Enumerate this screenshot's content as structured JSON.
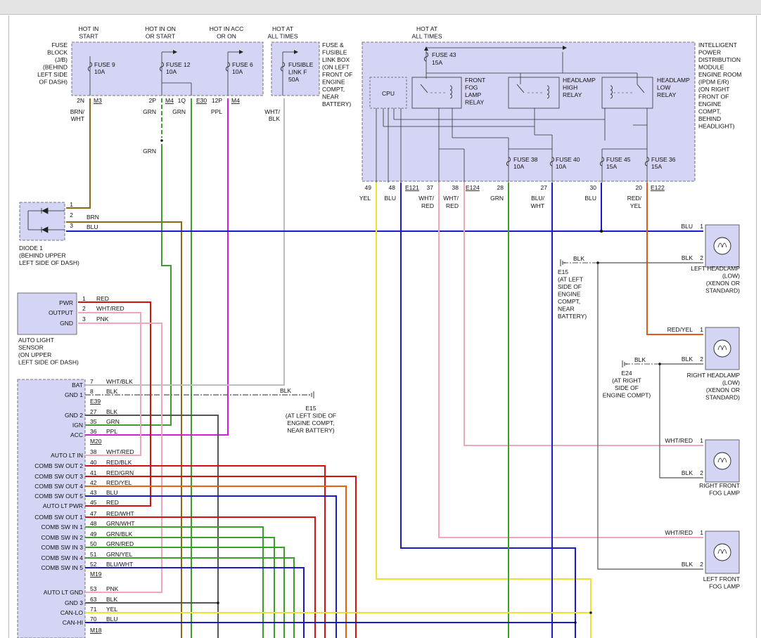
{
  "header_columns": [
    {
      "lines": [
        "HOT IN",
        "START"
      ]
    },
    {
      "lines": [
        "HOT IN ON",
        "OR START"
      ]
    },
    {
      "lines": [
        "HOT IN ACC",
        "OR ON"
      ]
    },
    {
      "lines": [
        "HOT AT",
        "ALL TIMES"
      ]
    },
    {
      "lines": [
        "HOT AT",
        "ALL TIMES"
      ]
    }
  ],
  "fuse_block": {
    "lines": [
      "FUSE",
      "BLOCK",
      "(J/B)",
      "(BEHIND",
      "LEFT SIDE",
      "OF DASH)"
    ],
    "fuses": [
      {
        "name": "FUSE 9",
        "rating": "10A"
      },
      {
        "name": "FUSE 12",
        "rating": "10A"
      },
      {
        "name": "FUSE 6",
        "rating": "10A"
      }
    ]
  },
  "fusible_box": {
    "lines": [
      "FUSE &",
      "FUSIBLE",
      "LINK BOX",
      "(ON LEFT",
      "FRONT OF",
      "ENGINE",
      "COMPT,",
      "NEAR",
      "BATTERY)"
    ],
    "link": [
      "FUSIBLE",
      "LINK F",
      "50A"
    ]
  },
  "ipdm": {
    "lines": [
      "INTELLIGENT",
      "POWER",
      "DISTRIBUTION",
      "MODULE",
      "ENGINE ROOM",
      "(IPDM E/R)",
      "(ON RIGHT",
      "FRONT OF",
      "ENGINE",
      "COMPT,",
      "BEHIND",
      "HEADLIGHT)"
    ],
    "fuse43": {
      "name": "FUSE 43",
      "rating": "15A"
    },
    "cpu": "CPU",
    "relays": [
      [
        "FRONT",
        "FOG",
        "LAMP",
        "RELAY"
      ],
      [
        "HEADLAMP",
        "HIGH",
        "RELAY"
      ],
      [
        "HEADLAMP",
        "LOW",
        "RELAY"
      ]
    ],
    "fuses": [
      {
        "name": "FUSE 38",
        "rating": "10A"
      },
      {
        "name": "FUSE 40",
        "rating": "10A"
      },
      {
        "name": "FUSE 45",
        "rating": "15A"
      },
      {
        "name": "FUSE 36",
        "rating": "15A"
      }
    ]
  },
  "pins_top": [
    "2N",
    "2P",
    "1Q",
    "12P",
    "49",
    "48",
    "37",
    "38",
    "28",
    "27",
    "30",
    "20"
  ],
  "connectors_top": [
    "M3",
    "M4",
    "E30",
    "M4",
    "E121",
    "E124",
    "E122"
  ],
  "wires_top": [
    "BRN/",
    "WHT",
    "GRN",
    "GRN",
    "PPL",
    "WHT/",
    "BLK",
    "GRN",
    "YEL",
    "BLU",
    "WHT/",
    "RED",
    "WHT/",
    "RED",
    "GRN",
    "BLU/",
    "WHT",
    "BLU",
    "RED/",
    "YEL"
  ],
  "diode": {
    "lines": [
      "DIODE 1",
      "(BEHIND UPPER",
      "LEFT SIDE OF DASH)"
    ],
    "pins": [
      "1",
      "2",
      "3"
    ],
    "wires": [
      "BRN",
      "BLU"
    ]
  },
  "sensor": {
    "terminals": [
      "PWR",
      "OUTPUT",
      "GND"
    ],
    "pins": [
      "1",
      "2",
      "3"
    ],
    "wires": [
      "RED",
      "WHT/RED",
      "PNK"
    ],
    "lines": [
      "AUTO LIGHT",
      "SENSOR",
      "(ON UPPER",
      "LEFT SIDE OF DASH)"
    ]
  },
  "bcm_rows": [
    {
      "term": "BAT",
      "pin": "7",
      "wire": "WHT/BLK"
    },
    {
      "term": "GND 1",
      "pin": "8",
      "wire": "BLK"
    },
    {
      "term": "GND 2",
      "pin": "27",
      "wire": "BLK"
    },
    {
      "term": "IGN",
      "pin": "35",
      "wire": "GRN"
    },
    {
      "term": "ACC",
      "pin": "36",
      "wire": "PPL"
    },
    {
      "term": "AUTO LT IN",
      "pin": "38",
      "wire": "WHT/RED"
    },
    {
      "term": "COMB SW OUT 2",
      "pin": "40",
      "wire": "RED/BLK"
    },
    {
      "term": "COMB SW OUT 3",
      "pin": "41",
      "wire": "RED/GRN"
    },
    {
      "term": "COMB SW OUT 4",
      "pin": "42",
      "wire": "RED/YEL"
    },
    {
      "term": "COMB SW OUT 5",
      "pin": "43",
      "wire": "BLU"
    },
    {
      "term": "AUTO LT PWR",
      "pin": "45",
      "wire": "RED"
    },
    {
      "term": "COMB SW OUT 1",
      "pin": "47",
      "wire": "RED/WHT"
    },
    {
      "term": "COMB SW IN 1",
      "pin": "48",
      "wire": "GRN/WHT"
    },
    {
      "term": "COMB SW IN 2",
      "pin": "49",
      "wire": "GRN/BLK"
    },
    {
      "term": "COMB SW IN 3",
      "pin": "50",
      "wire": "GRN/RED"
    },
    {
      "term": "COMB SW IN 4",
      "pin": "51",
      "wire": "GRN/YEL"
    },
    {
      "term": "COMB SW IN 5",
      "pin": "52",
      "wire": "BLU/WHT"
    },
    {
      "term": "AUTO LT GND",
      "pin": "53",
      "wire": "PNK"
    },
    {
      "term": "GND 3",
      "pin": "63",
      "wire": "BLK"
    },
    {
      "term": "CAN-LO",
      "pin": "71",
      "wire": "YEL"
    },
    {
      "term": "CAN-HI",
      "pin": "70",
      "wire": "BLU"
    }
  ],
  "bcm_connectors": [
    "E39",
    "M20",
    "M19",
    "M18"
  ],
  "grounds": [
    {
      "wire": "BLK",
      "lines": [
        "E15",
        "(AT LEFT SIDE OF",
        "ENGINE COMPT,",
        "NEAR BATTERY)"
      ]
    },
    {
      "wire": "BLK",
      "lines": [
        "E15",
        "(AT LEFT",
        "SIDE OF",
        "ENGINE",
        "COMPT,",
        "NEAR",
        "BATTERY)"
      ]
    },
    {
      "wire": "BLK",
      "lines": [
        "E24",
        "(AT RIGHT",
        "SIDE OF",
        "ENGINE COMPT)"
      ]
    }
  ],
  "lamps": [
    {
      "wire1": "BLU",
      "wire2": "BLK",
      "lines": [
        "LEFT HEADLAMP",
        "(LOW)",
        "(XENON OR",
        "STANDARD)"
      ]
    },
    {
      "wire1": "RED/YEL",
      "wire2": "BLK",
      "lines": [
        "RIGHT HEADLAMP",
        "(LOW)",
        "(XENON OR",
        "STANDARD)"
      ]
    },
    {
      "wire1": "WHT/RED",
      "wire2": "BLK",
      "lines": [
        "RIGHT FRONT",
        "FOG LAMP"
      ]
    },
    {
      "wire1": "WHT/RED",
      "wire2": "BLK",
      "lines": [
        "LEFT FRONT",
        "FOG LAMP"
      ]
    }
  ],
  "lamp_pins": [
    "1",
    "2"
  ],
  "mid_wire": "GRN",
  "colors": {
    "module_fill": "#d4d4f4",
    "brn": "#8b6914",
    "grn": "#3aa02a",
    "ppl": "#d41fd4",
    "wht": "#bdbdbd",
    "yel": "#f0e030",
    "blu": "#1a1ac8",
    "red": "#d41010",
    "pnk": "#f0a8b8",
    "redyel": "#e05a1a",
    "blk": "#555555",
    "orange": "#e8620e"
  }
}
